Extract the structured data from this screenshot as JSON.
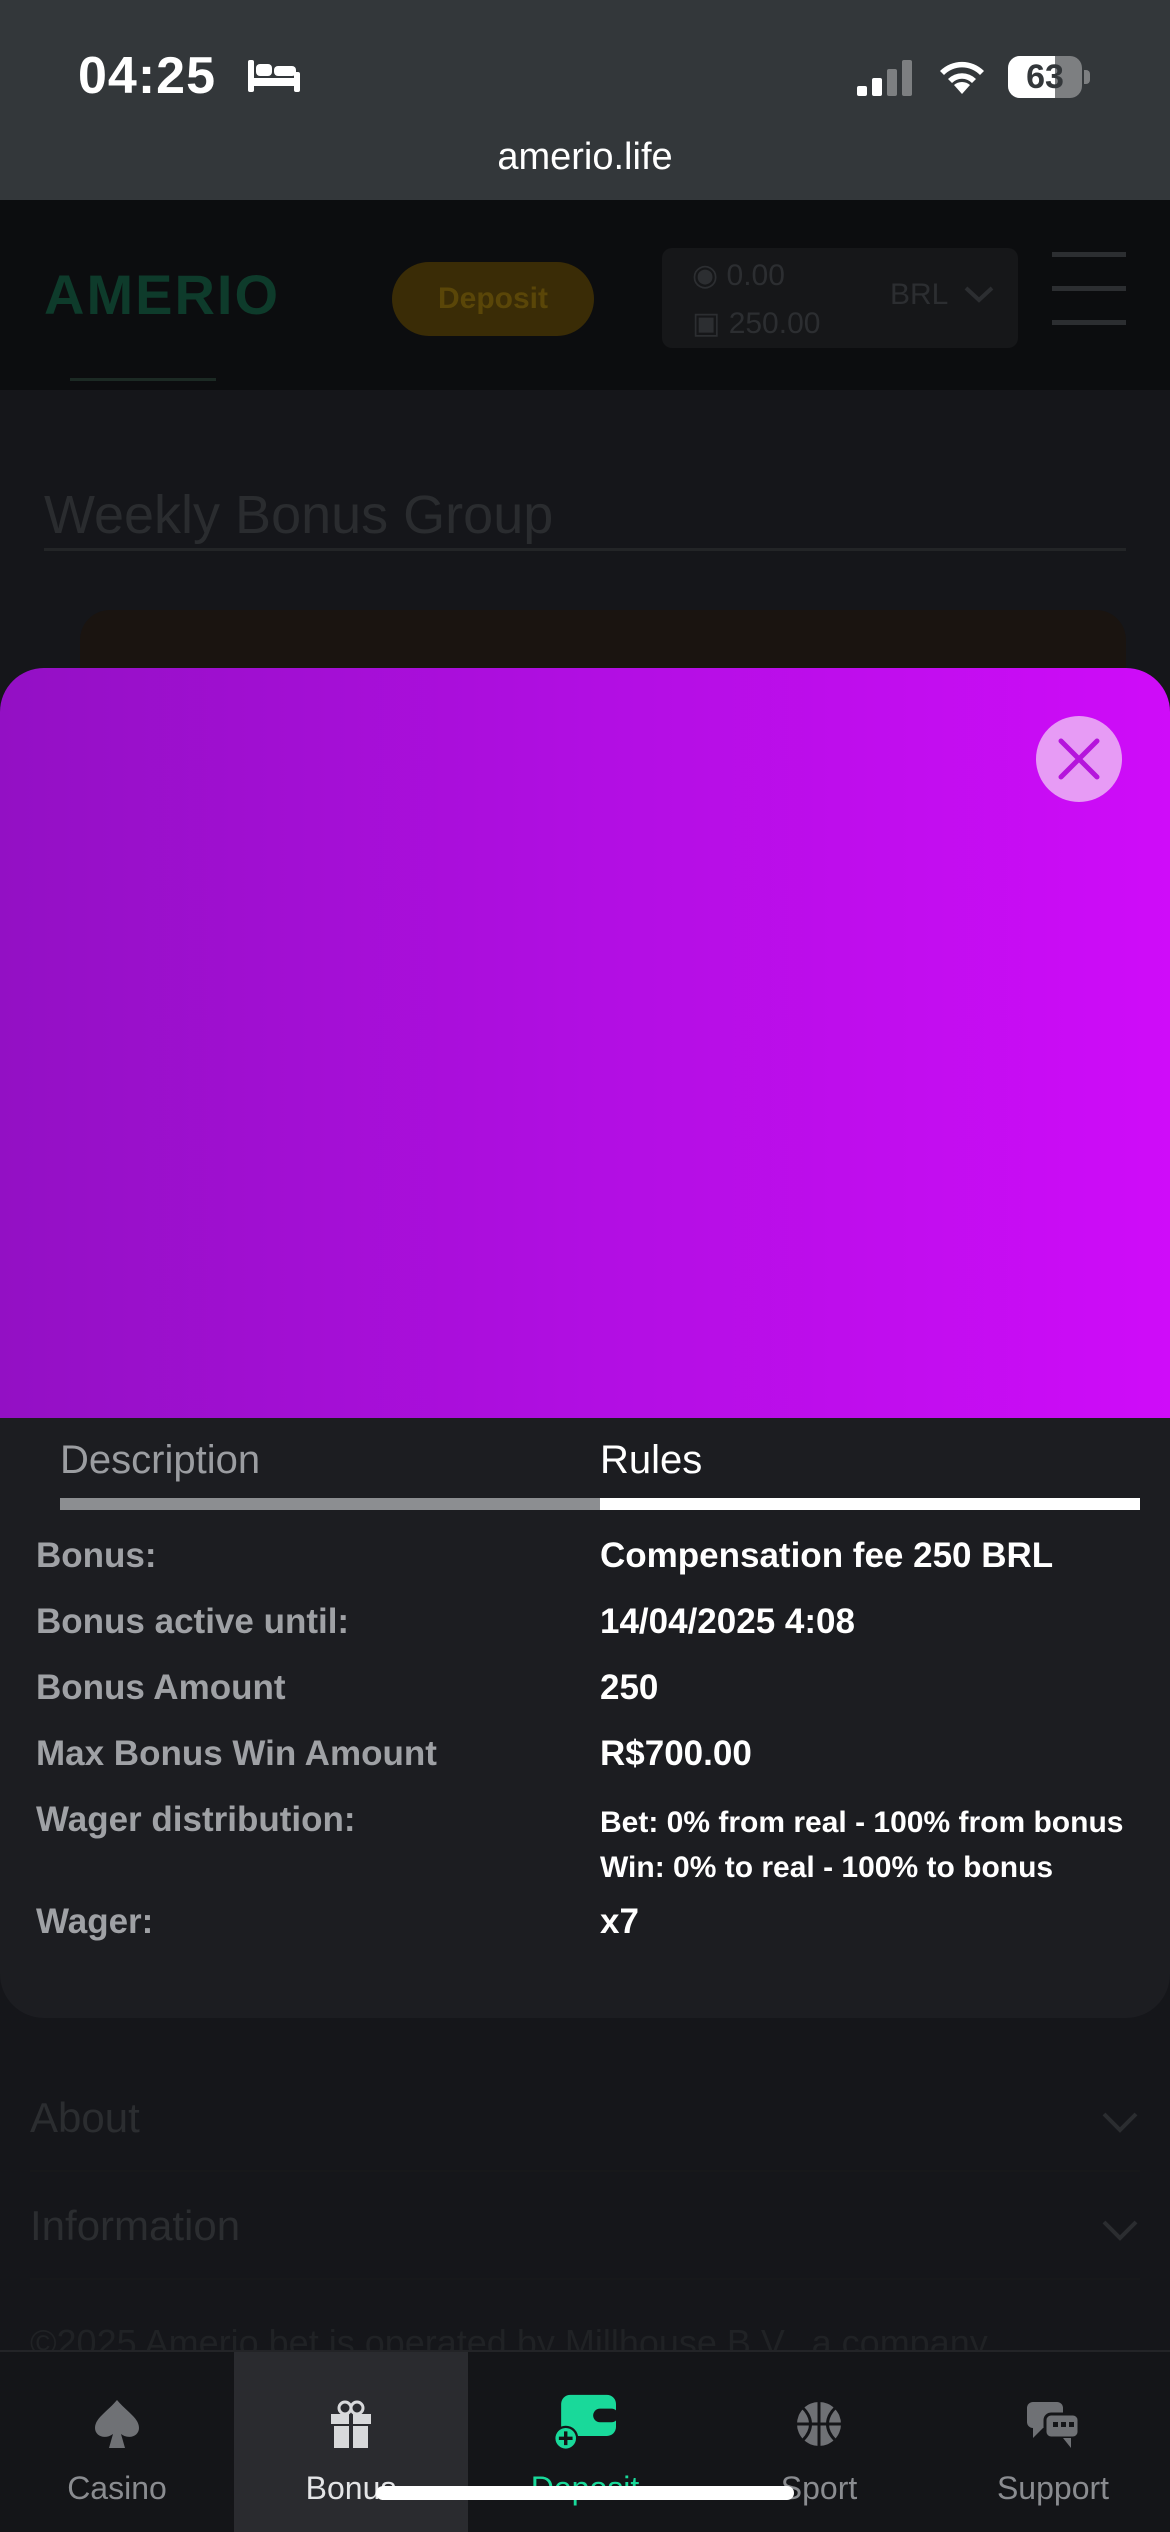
{
  "status_bar": {
    "time": "04:25",
    "battery": "63",
    "battery_level": 0.63,
    "url": "amerio.life"
  },
  "header": {
    "logo": "AMERIO",
    "deposit_label": "Deposit",
    "balance_real": "0.00",
    "balance_bonus": "250.00",
    "currency": "BRL"
  },
  "page": {
    "title": "Weekly Bonus Group",
    "sections": [
      "About",
      "Information"
    ],
    "footer": "©2025 Amerio.bet is operated by Millhouse B.V., a company"
  },
  "modal": {
    "tabs": [
      {
        "label": "Description",
        "active": false
      },
      {
        "label": "Rules",
        "active": true
      }
    ],
    "rules": [
      {
        "key": "Bonus:",
        "value": "Compensation fee 250 BRL"
      },
      {
        "key": "Bonus active until:",
        "value": "14/04/2025 4:08"
      },
      {
        "key": "Bonus Amount",
        "value": "250"
      },
      {
        "key": "Max Bonus Win Amount",
        "value": "R$700.00"
      },
      {
        "key": "Wager distribution:",
        "value_lines": [
          "Bet: 0% from real - 100% from bonus",
          "Win: 0% to real - 100% to bonus"
        ]
      },
      {
        "key": "Wager:",
        "value": "x7"
      }
    ],
    "colors": {
      "hero_start": "#9310c4",
      "hero_end": "#cf0cf9",
      "close_bg": "#e79bf5"
    }
  },
  "bottom_nav": [
    {
      "label": "Casino",
      "icon": "spade-icon"
    },
    {
      "label": "Bonus",
      "icon": "gift-icon",
      "selected": true
    },
    {
      "label": "Deposit",
      "icon": "wallet-icon"
    },
    {
      "label": "Sport",
      "icon": "basketball-icon"
    },
    {
      "label": "Support",
      "icon": "chat-icon"
    }
  ],
  "accent_color": "#19d99a"
}
